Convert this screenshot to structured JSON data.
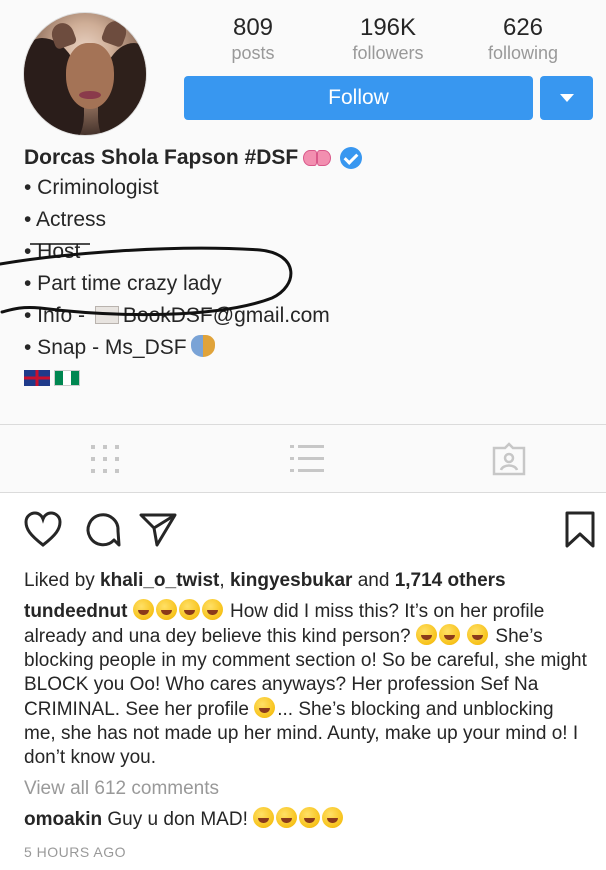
{
  "profile": {
    "avatar_icon": "profile-photo-with-dog-ears-filter",
    "stats": {
      "posts": {
        "value": "809",
        "label": "posts"
      },
      "followers": {
        "value": "196K",
        "label": "followers"
      },
      "following": {
        "value": "626",
        "label": "following"
      }
    },
    "follow_label": "Follow",
    "dropdown_icon": "chevron-down-icon",
    "accent_color": "#3897f0",
    "bio": {
      "name": "Dorcas Shola Fapson #DSF",
      "name_icons": [
        "ribbon-bow-emoji",
        "verified-badge-icon"
      ],
      "lines": {
        "l1": "• Criminologist",
        "l2": "• Actress",
        "l3": "• Host",
        "l4": "• Part time crazy lady",
        "l5_prefix": "• Info - ",
        "l5_email": "BookDSF@gmail.com",
        "l6": "• Snap - Ms_DSF"
      },
      "flags": [
        "uk-flag",
        "nigeria-flag"
      ]
    }
  },
  "tabs": [
    "grid-view-icon",
    "list-view-icon",
    "tagged-photos-icon"
  ],
  "post": {
    "action_icons": [
      "heart-icon",
      "comment-icon",
      "share-icon",
      "bookmark-icon"
    ],
    "likes": {
      "prefix": "Liked by ",
      "user1": "khali_o_twist",
      "sep": ", ",
      "user2": "kingyesbukar",
      "and": " and ",
      "others": "1,714 others"
    },
    "caption": {
      "user": "tundeednut",
      "t1": " How did I miss this? It’s on her profile already and una dey believe this kind person? ",
      "t2": " She’s blocking people in my comment section o! So be careful, she might BLOCK you Oo! Who cares anyways? Her profession Sef Na CRIMINAL. See her profile ",
      "t3": "... She’s blocking and unblocking me, she has not made up her mind. Aunty, make up your mind o! I don’t know you."
    },
    "view_all": "View all 612 comments",
    "comment": {
      "user": "omoakin",
      "text": " Guy u don MAD! "
    },
    "time_ago": "5 HOURS AGO"
  }
}
